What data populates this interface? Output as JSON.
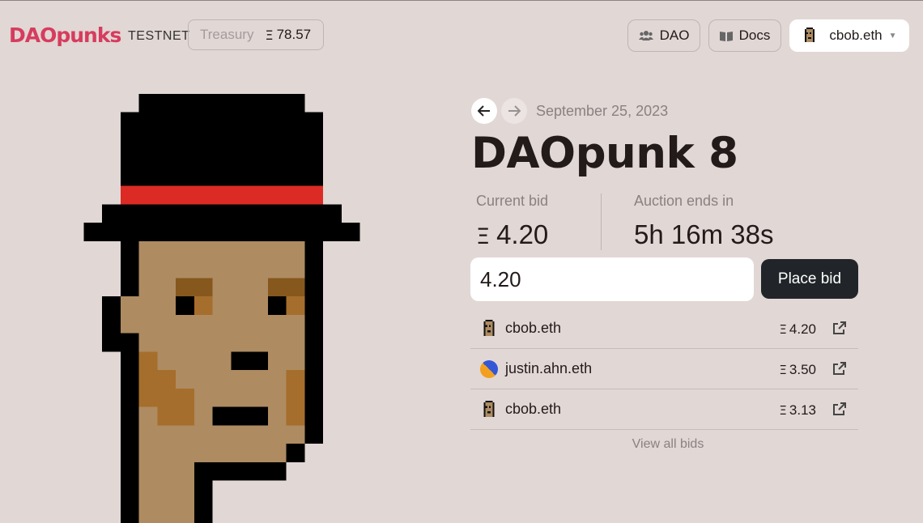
{
  "header": {
    "logo": "DAOpunks",
    "network": "TESTNET",
    "treasury_label": "Treasury",
    "eth_symbol": "Ξ",
    "treasury_value": "78.57",
    "dao_label": "DAO",
    "docs_label": "Docs",
    "account_label": "cbob.eth"
  },
  "auction": {
    "date": "September 25, 2023",
    "title": "DAOpunk 8",
    "current_bid_label": "Current bid",
    "current_bid_value": "4.20",
    "ends_label": "Auction ends in",
    "ends_value": "5h 16m 38s",
    "bid_input_value": "4.20",
    "place_bid_label": "Place bid",
    "view_all_label": "View all bids"
  },
  "bids": [
    {
      "name": "cbob.eth",
      "amount": "4.20",
      "avatar": "punk-avatar"
    },
    {
      "name": "justin.ahn.eth",
      "amount": "3.50",
      "avatar": "gradient-avatar"
    },
    {
      "name": "cbob.eth",
      "amount": "3.13",
      "avatar": "punk-avatar"
    }
  ],
  "colors": {
    "background": "#e1d7d5",
    "brand": "#d63c5e",
    "hat_band": "#dc2b24",
    "skin": "#ae8b61",
    "button_dark": "#212529"
  }
}
